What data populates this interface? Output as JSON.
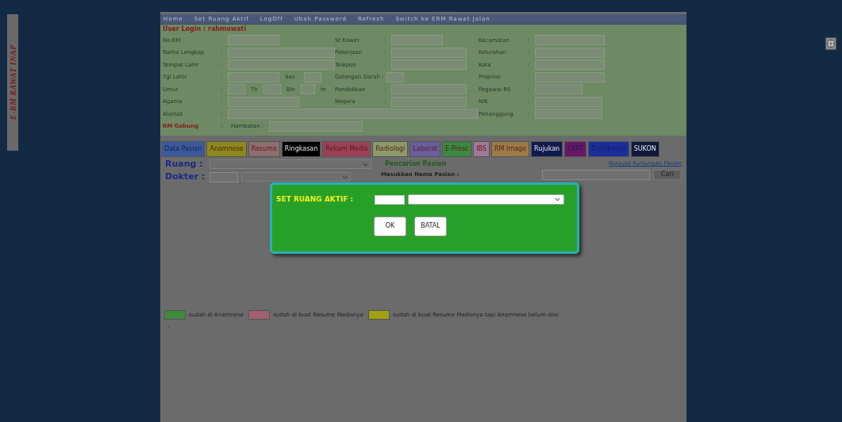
{
  "side_label": "E-RM RAWAT INAP",
  "menu": [
    "Home",
    "Set Ruang Aktif",
    "LogOff",
    "Ubah Password",
    "Refresh",
    "Switch ke ERM Rawat Jalan"
  ],
  "user_login": "User Login : rahmowati",
  "form_rows": [
    {
      "columns": [
        [
          {
            "kind": "label",
            "text": "No.RM"
          },
          {
            "kind": "sep",
            "text": ":"
          },
          {
            "kind": "input"
          }
        ],
        [
          {
            "kind": "label",
            "text": "St.Kawin"
          },
          {
            "kind": "sep",
            "text": ":"
          },
          {
            "kind": "input"
          }
        ],
        [
          {
            "kind": "label",
            "text": "Kecamatan"
          },
          {
            "kind": "sep",
            "text": ":"
          },
          {
            "kind": "input"
          }
        ]
      ]
    },
    {
      "columns": [
        [
          {
            "kind": "label",
            "text": "Nama Lengkap"
          },
          {
            "kind": "sep",
            "text": ":"
          },
          {
            "kind": "input"
          }
        ],
        [
          {
            "kind": "label",
            "text": "Pekerjaan"
          },
          {
            "kind": "sep",
            "text": ":"
          },
          {
            "kind": "input"
          }
        ],
        [
          {
            "kind": "label",
            "text": "Kelurahan"
          },
          {
            "kind": "sep",
            "text": ":"
          },
          {
            "kind": "input"
          }
        ]
      ]
    },
    {
      "columns": [
        [
          {
            "kind": "label",
            "text": "Tempat Lahir"
          },
          {
            "kind": "sep",
            "text": ":"
          },
          {
            "kind": "input"
          }
        ],
        [
          {
            "kind": "label",
            "text": "Telepon"
          },
          {
            "kind": "sep",
            "text": ":"
          },
          {
            "kind": "input"
          }
        ],
        [
          {
            "kind": "label",
            "text": "Kota"
          },
          {
            "kind": "sep",
            "text": ":"
          },
          {
            "kind": "input"
          }
        ]
      ]
    },
    {
      "columns": [
        [
          {
            "kind": "label",
            "text": "Tgl.Lahir"
          },
          {
            "kind": "sep",
            "text": ":"
          },
          {
            "kind": "input"
          },
          {
            "kind": "inline",
            "text": "Sex :"
          },
          {
            "kind": "input"
          }
        ],
        [
          {
            "kind": "label",
            "text": "Golongan Darah :"
          },
          {
            "kind": "input"
          }
        ],
        [
          {
            "kind": "label",
            "text": "Propinsi"
          },
          {
            "kind": "sep",
            "text": ":"
          },
          {
            "kind": "input"
          }
        ]
      ]
    },
    {
      "columns": [
        [
          {
            "kind": "label",
            "text": "Umur"
          },
          {
            "kind": "sep",
            "text": ":"
          },
          {
            "kind": "input"
          },
          {
            "kind": "inline",
            "text": "Th"
          },
          {
            "kind": "input"
          },
          {
            "kind": "inline",
            "text": "Bln"
          },
          {
            "kind": "input"
          },
          {
            "kind": "inline",
            "text": "hr"
          }
        ],
        [
          {
            "kind": "label",
            "text": "Pendidikan"
          },
          {
            "kind": "sep",
            "text": ":"
          },
          {
            "kind": "input"
          }
        ],
        [
          {
            "kind": "label",
            "text": "Pegawai RS"
          },
          {
            "kind": "sep",
            "text": ":"
          },
          {
            "kind": "input"
          }
        ]
      ]
    },
    {
      "columns": [
        [
          {
            "kind": "label",
            "text": "Agama"
          },
          {
            "kind": "sep",
            "text": ":"
          },
          {
            "kind": "input"
          }
        ],
        [
          {
            "kind": "label",
            "text": "Negara"
          },
          {
            "kind": "sep",
            "text": ":"
          },
          {
            "kind": "input"
          }
        ],
        [
          {
            "kind": "label",
            "text": "NIK"
          },
          {
            "kind": "sep",
            "text": ":"
          },
          {
            "kind": "input"
          }
        ]
      ]
    },
    {
      "columns": [
        [
          {
            "kind": "label",
            "text": "Alamat"
          },
          {
            "kind": "sep",
            "text": ":"
          },
          {
            "kind": "input"
          }
        ],
        [
          {
            "kind": "label",
            "text": "Penanggung"
          },
          {
            "kind": "sep",
            "text": ":"
          },
          {
            "kind": "input"
          }
        ]
      ]
    },
    {
      "columns": [
        [
          {
            "kind": "warn",
            "text": "RM Gabung"
          },
          {
            "kind": "sep",
            "text": ":"
          },
          {
            "kind": "inline",
            "text": "Hambatan :"
          },
          {
            "kind": "input"
          }
        ]
      ]
    }
  ],
  "tabs": [
    {
      "label": "Data Pasien",
      "color": "#3a5a9c"
    },
    {
      "label": "Anamnese",
      "color": "#8c8a1c"
    },
    {
      "label": "Resume",
      "color": "#8e6e6e"
    },
    {
      "label": "Ringkasan",
      "color": "#000000"
    },
    {
      "label": "Rekam Medis",
      "color": "#9c4058"
    },
    {
      "label": "Radiologi",
      "color": "#8a9a68"
    },
    {
      "label": "Laborat",
      "color": "#6a5e9c"
    },
    {
      "label": "E-Presc",
      "color": "#3a8a40"
    },
    {
      "label": "IBS",
      "color": "#a07a98"
    },
    {
      "label": "RM Image",
      "color": "#9c7c44"
    },
    {
      "label": "Rujukan",
      "color": "#101a50"
    },
    {
      "label": "CPPT",
      "color": "#6a1468"
    },
    {
      "label": "Dashboard",
      "color": "#1a2ea0"
    },
    {
      "label": "SUKON",
      "color": "#10183c"
    }
  ],
  "ruang_label": "Ruang :",
  "dokter_label": "Dokter :",
  "search_title": "Pencarian Pasien",
  "search_label": "Masukkan Nama Pasien :",
  "search_button": "Cari",
  "history_link": "Riwayat Kunjungan Pasien",
  "dialog": {
    "title": "SET RUANG AKTIF :",
    "buttons": [
      "OK",
      "BATAL"
    ]
  },
  "legend": [
    {
      "color": "#3f8a3f",
      "text": "sudah di Anamnese"
    },
    {
      "color": "#a06070",
      "text": "sudah di buat Resume Medisnya"
    },
    {
      "color": "#a0a010",
      "text": "sudah di buat Resume Medisnya tapi Anamnese belum diisi"
    }
  ],
  "note_mark": "-"
}
